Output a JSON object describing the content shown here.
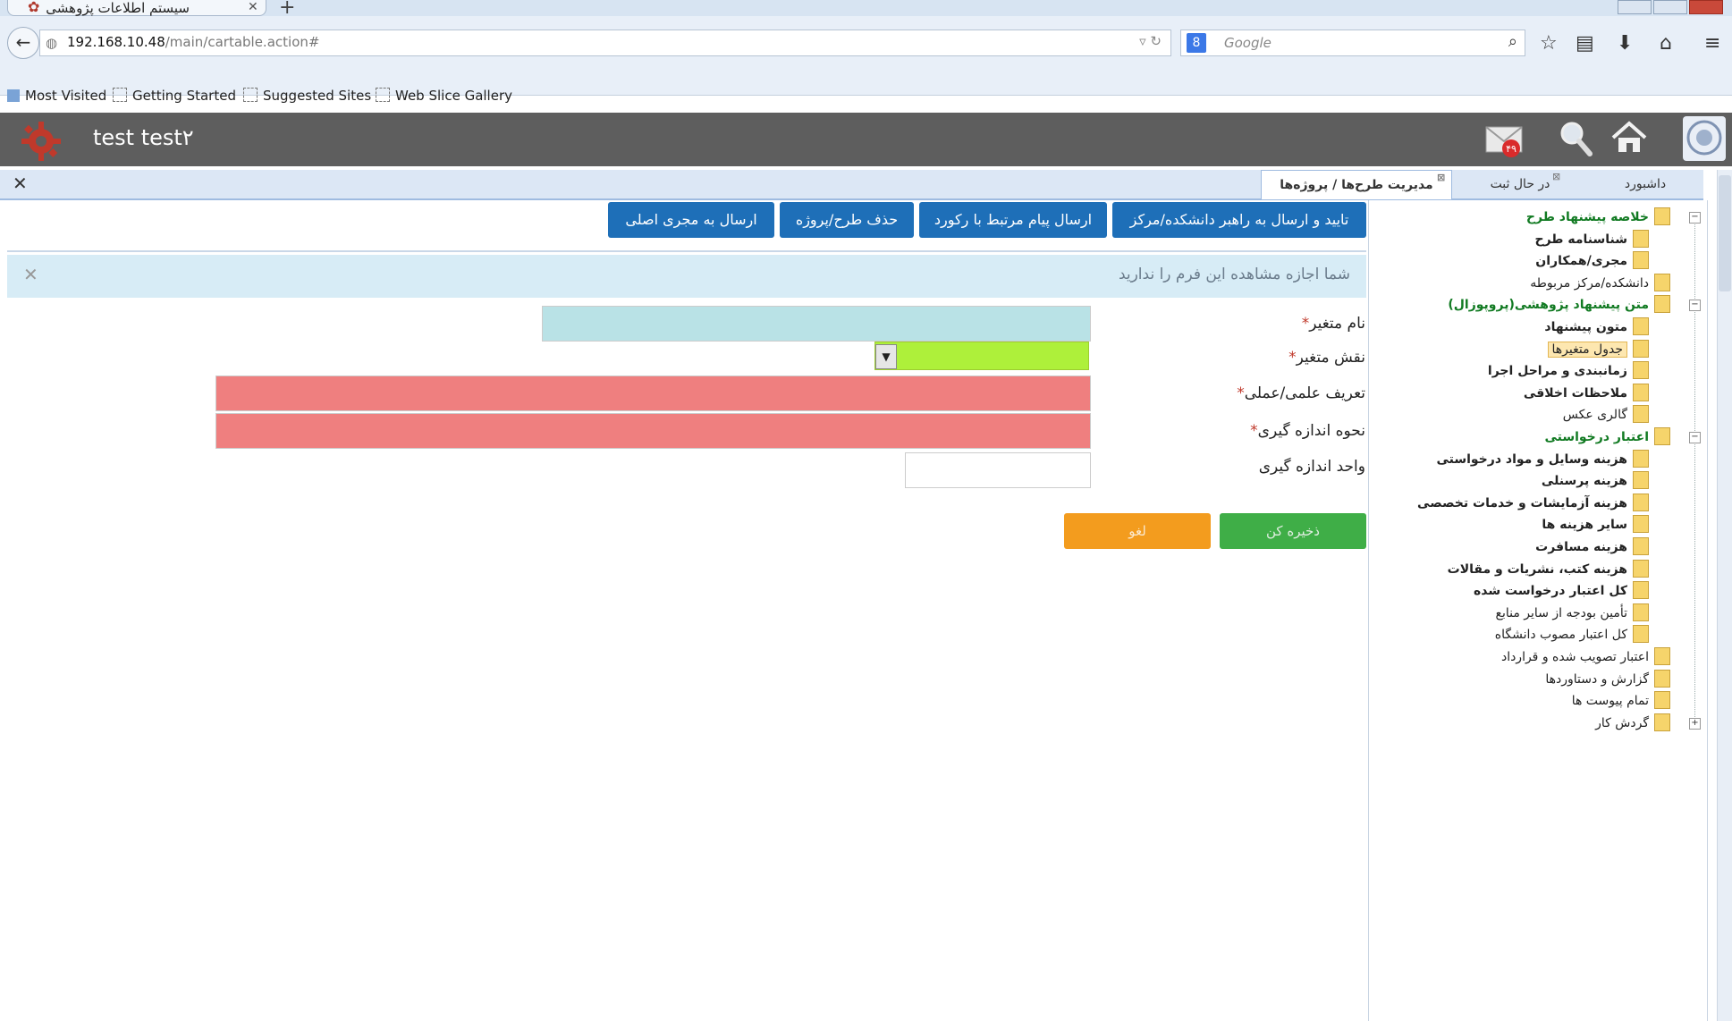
{
  "browser": {
    "tab_title": "سیستم اطلاعات پژوهشی",
    "url_host": "192.168.10.48",
    "url_path": "/main/cartable.action#",
    "search_placeholder": "Google",
    "bookmarks": [
      "Most Visited",
      "Getting Started",
      "Suggested Sites",
      "Web Slice Gallery"
    ]
  },
  "header": {
    "username": "test test۲",
    "mail_badge": "۴۹"
  },
  "tabs": [
    {
      "label": "داشبورد"
    },
    {
      "label": "در حال ثبت"
    },
    {
      "label": "مدیریت طرح‌ها / پروژه‌ها"
    }
  ],
  "actions": {
    "confirm_send": "تایید و ارسال به راهبر دانشکده/مرکز",
    "send_message": "ارسال پیام مرتبط با رکورد",
    "delete_project": "حذف طرح/پروژه",
    "send_to_main": "ارسال به مجری اصلی"
  },
  "alert": {
    "text": "شما اجازه مشاهده این فرم را ندارید"
  },
  "form": {
    "name_label": "نام متغیر",
    "role_label": "نقش متغیر",
    "definition_label": "تعریف علمی/عملی",
    "measure_label": "نحوه اندازه گیری",
    "unit_label": "واحد اندازه گیری",
    "required_mark": "*",
    "save_label": "ذخیره کن",
    "cancel_label": "لغو"
  },
  "tree": [
    {
      "label": "خلاصه پیشنهاد طرح",
      "style": "green",
      "level": 0,
      "toggle": "−"
    },
    {
      "label": "شناسنامه طرح",
      "style": "bold",
      "level": 1
    },
    {
      "label": "مجری/همکاران",
      "style": "bold",
      "level": 1
    },
    {
      "label": "دانشکده/مرکز مربوطه",
      "style": "normal",
      "level": 0
    },
    {
      "label": "متن پیشنهاد پژوهشی(پروپوزال)",
      "style": "green",
      "level": 0,
      "toggle": "−"
    },
    {
      "label": "متون پیشنهاد",
      "style": "bold",
      "level": 1
    },
    {
      "label": "جدول متغیرها",
      "style": "sel",
      "level": 1
    },
    {
      "label": "زمانبندی و مراحل اجرا",
      "style": "bold",
      "level": 1
    },
    {
      "label": "ملاحظات اخلاقی",
      "style": "bold",
      "level": 1
    },
    {
      "label": "گالری عکس",
      "style": "normal",
      "level": 1
    },
    {
      "label": "اعتبار درخواستی",
      "style": "green",
      "level": 0,
      "toggle": "−"
    },
    {
      "label": "هزینه وسایل و مواد درخواستی",
      "style": "bold",
      "level": 1
    },
    {
      "label": "هزینه پرسنلی",
      "style": "bold",
      "level": 1
    },
    {
      "label": "هزینه آزمایشات و خدمات تخصصی",
      "style": "bold",
      "level": 1
    },
    {
      "label": "سایر هزینه ها",
      "style": "bold",
      "level": 1
    },
    {
      "label": "هزینه مسافرت",
      "style": "bold",
      "level": 1
    },
    {
      "label": "هزینه کتب، نشریات و مقالات",
      "style": "bold",
      "level": 1
    },
    {
      "label": "کل اعتبار درخواست شده",
      "style": "bold",
      "level": 1
    },
    {
      "label": "تأمین بودجه از سایر منابع",
      "style": "normal",
      "level": 1
    },
    {
      "label": "کل اعتبار مصوب دانشگاه",
      "style": "normal",
      "level": 1
    },
    {
      "label": "اعتبار تصویب شده و قرارداد",
      "style": "normal",
      "level": 0
    },
    {
      "label": "گزارش و دستاوردها",
      "style": "normal",
      "level": 0
    },
    {
      "label": "تمام پیوست ها",
      "style": "normal",
      "level": 0
    },
    {
      "label": "گردش کار",
      "style": "normal",
      "level": 0,
      "toggle": "+"
    }
  ],
  "colors": {
    "header_bg": "#5e5e5e",
    "action_btn": "#1e6fb8",
    "save_btn": "#3fae47",
    "cancel_btn": "#f39c1e",
    "required_field": "#ef7f7f",
    "select_bg": "#aef03a"
  }
}
